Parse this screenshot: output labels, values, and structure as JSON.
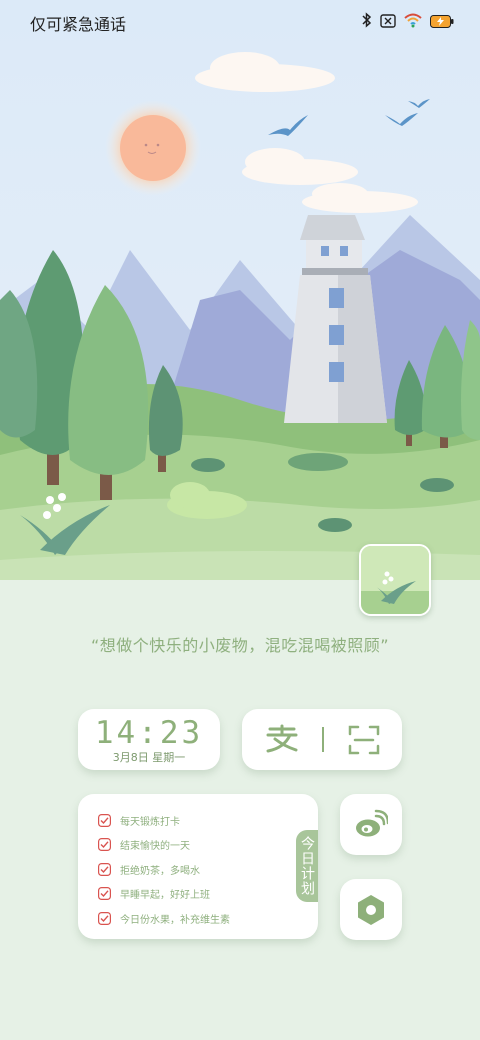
{
  "status_bar": {
    "carrier_text": "仅可紧急通话",
    "icons": [
      "bluetooth-icon",
      "no-sim-icon",
      "wifi-icon",
      "battery-charging-icon"
    ]
  },
  "quote": "“想做个快乐的小废物，混吃混喝被照顾”",
  "clock": {
    "time": "14:23",
    "date": "3月8日 星期一"
  },
  "payment": {
    "icons": [
      "alipay-icon",
      "scan-icon"
    ]
  },
  "todo": {
    "tab_label": "今日计划",
    "items": [
      {
        "label": "每天锻炼打卡",
        "checked": true
      },
      {
        "label": "结束愉快的一天",
        "checked": true
      },
      {
        "label": "拒绝奶茶，多喝水",
        "checked": true
      },
      {
        "label": "早睡早起，好好上班",
        "checked": true
      },
      {
        "label": "今日份水果，补充维生素",
        "checked": true
      }
    ]
  },
  "shortcuts": {
    "icons": [
      "weibo-icon",
      "settings-icon"
    ]
  },
  "colors": {
    "accent": "#8eb07a",
    "check": "#d9534f",
    "background": "#e6f1e6"
  }
}
